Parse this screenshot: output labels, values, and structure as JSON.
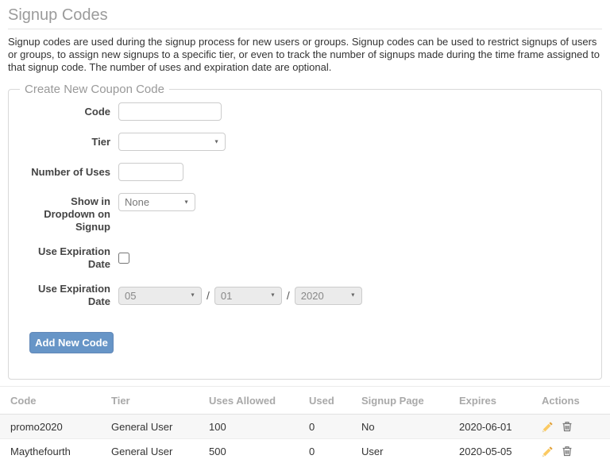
{
  "page": {
    "title": "Signup Codes",
    "description": "Signup codes are used during the signup process for new users or groups. Signup codes can be used to restrict signups of users or groups, to assign new signups to a specific tier, or even to track the number of signups made during the time frame assigned to that signup code. The number of uses and expiration date are optional."
  },
  "form": {
    "legend": "Create New Coupon Code",
    "code_label": "Code",
    "code_value": "",
    "tier_label": "Tier",
    "tier_value": "",
    "uses_label": "Number of Uses",
    "uses_value": "",
    "dropdown_label": "Show in Dropdown on Signup",
    "dropdown_value": "None",
    "expiration_checkbox_label": "Use Expiration Date",
    "expiration_date_label": "Use Expiration Date",
    "expiration_month": "05",
    "expiration_day": "01",
    "expiration_year": "2020",
    "date_separator": "/",
    "submit_label": "Add New Code"
  },
  "table": {
    "headers": [
      "Code",
      "Tier",
      "Uses Allowed",
      "Used",
      "Signup Page",
      "Expires",
      "Actions"
    ],
    "rows": [
      {
        "code": "promo2020",
        "tier": "General User",
        "uses_allowed": "100",
        "used": "0",
        "signup_page": "No",
        "expires": "2020-06-01"
      },
      {
        "code": "Maythefourth",
        "tier": "General User",
        "uses_allowed": "500",
        "used": "0",
        "signup_page": "User",
        "expires": "2020-05-05"
      }
    ]
  },
  "icons": {
    "select_arrow": "▼",
    "edit": "pencil-icon",
    "delete": "trash-icon"
  },
  "colors": {
    "accent_blue": "#6795c7",
    "pencil_icon": "#f5c04a",
    "trash_icon": "#777777",
    "stripe_row": "#f7f7f7"
  }
}
